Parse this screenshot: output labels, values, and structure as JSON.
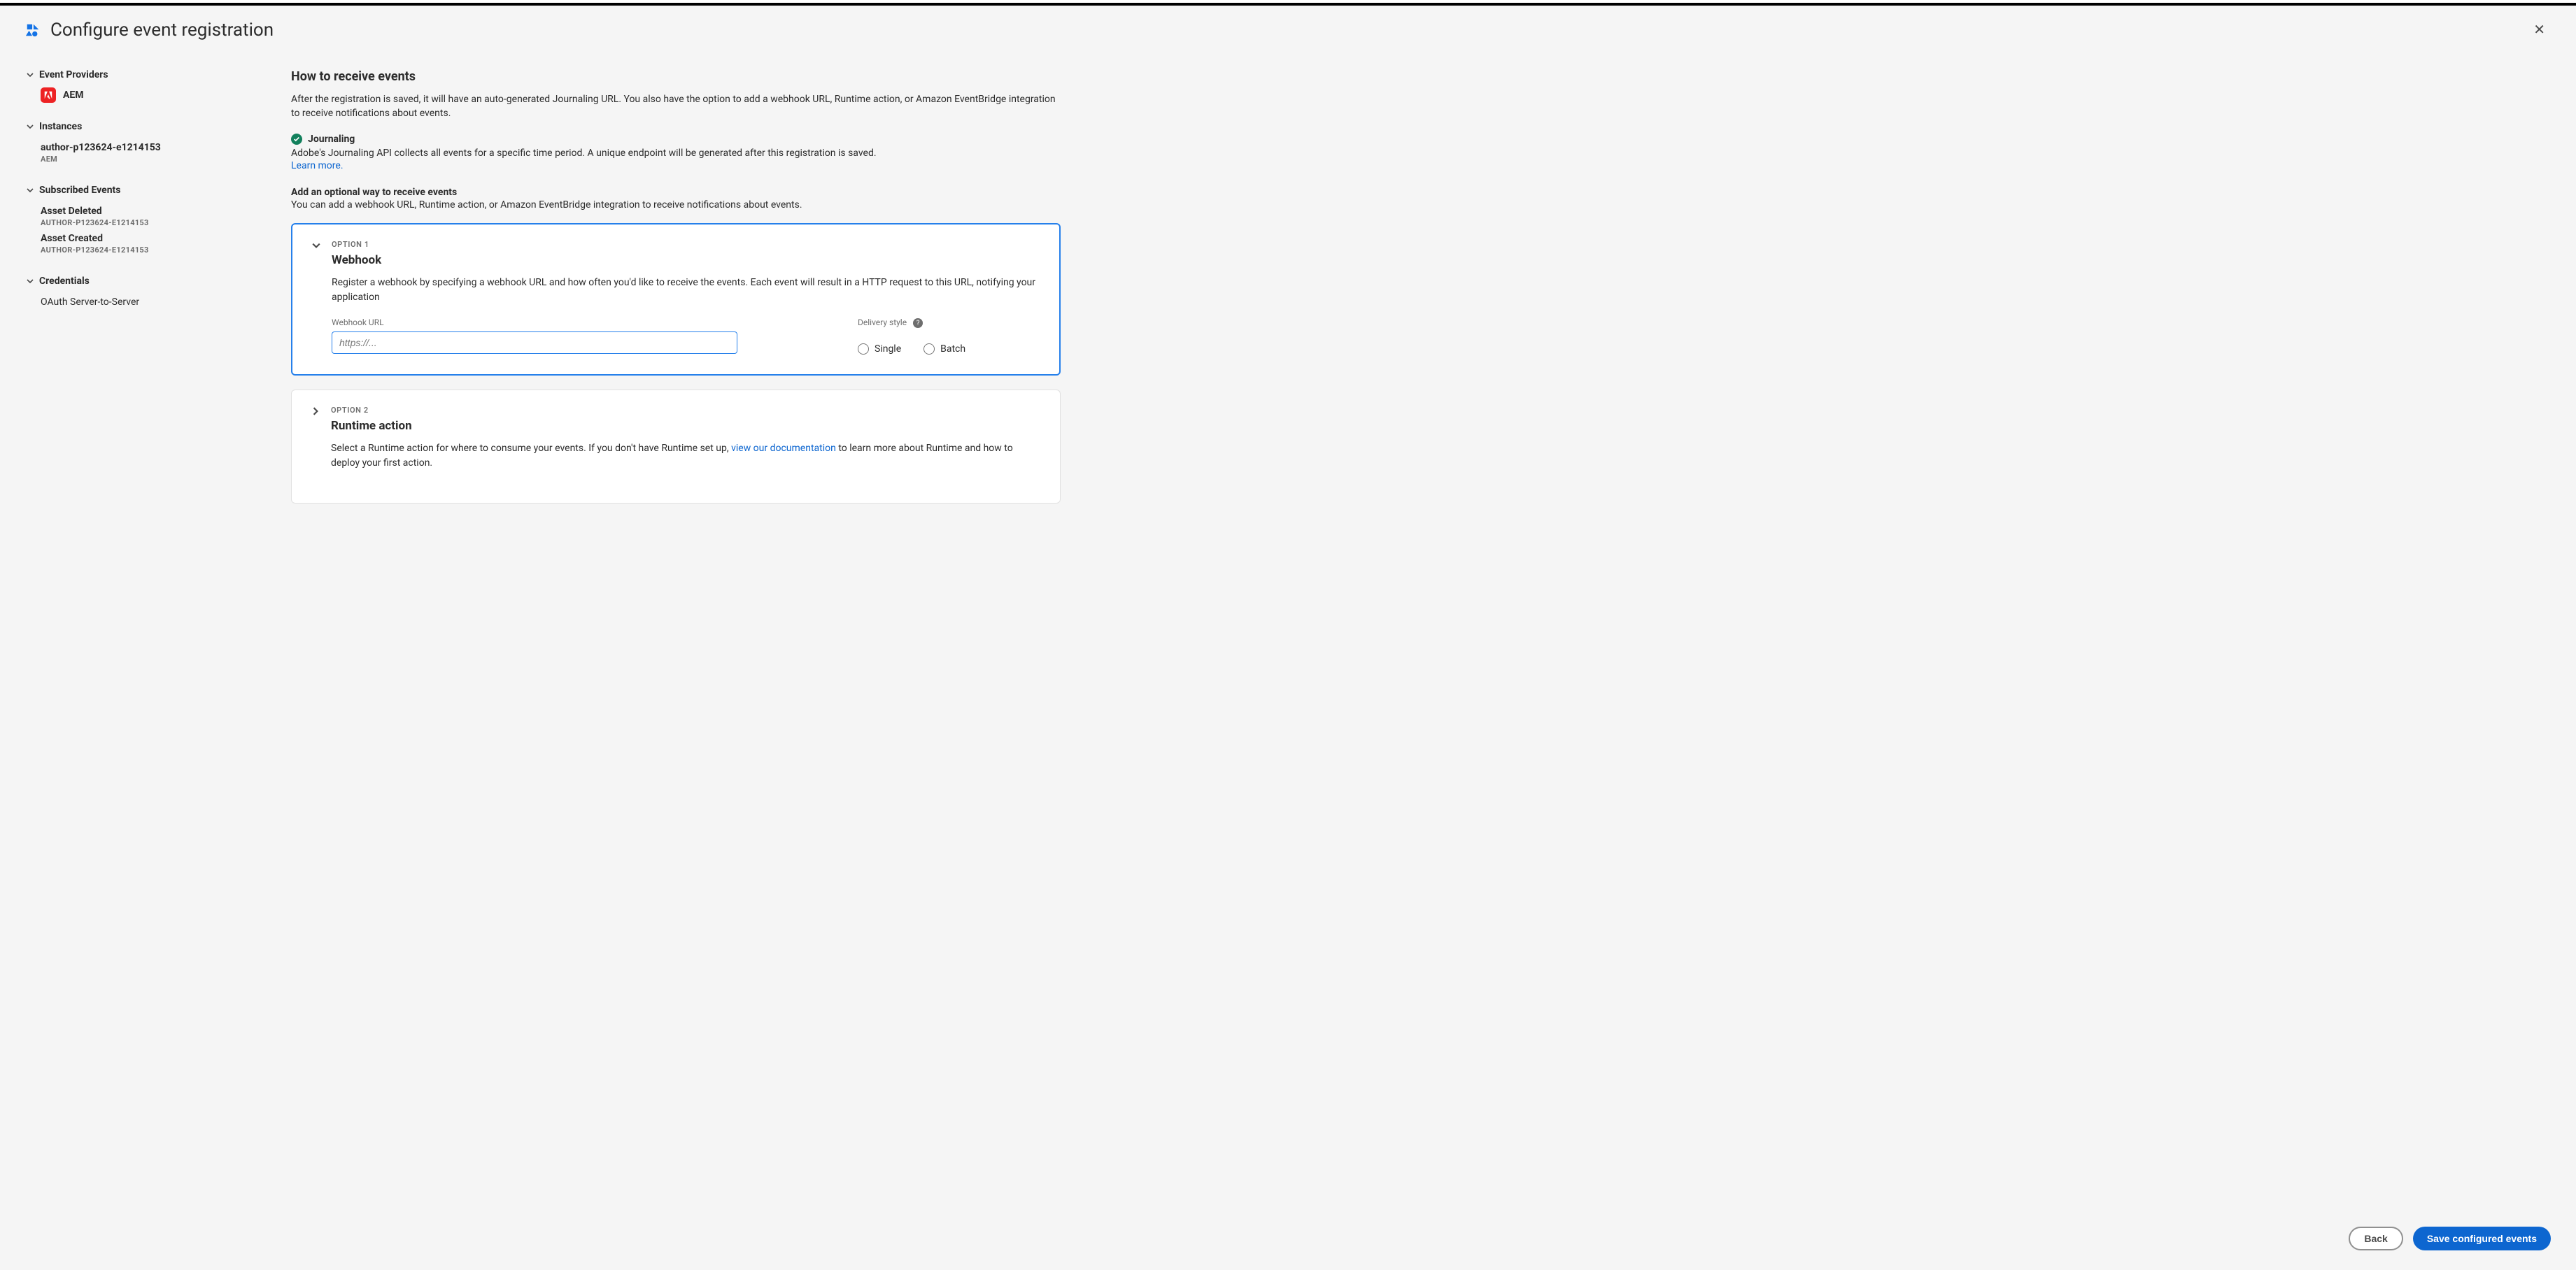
{
  "header": {
    "title": "Configure event registration"
  },
  "sidebar": {
    "providers_heading": "Event Providers",
    "provider_name": "AEM",
    "instances_heading": "Instances",
    "instance_name": "author-p123624-e1214153",
    "instance_sub": "AEM",
    "events_heading": "Subscribed Events",
    "events": [
      {
        "name": "Asset Deleted",
        "source": "AUTHOR-P123624-E1214153"
      },
      {
        "name": "Asset Created",
        "source": "AUTHOR-P123624-E1214153"
      }
    ],
    "credentials_heading": "Credentials",
    "credential_name": "OAuth Server-to-Server"
  },
  "main": {
    "heading": "How to receive events",
    "lead": "After the registration is saved, it will have an auto-generated Journaling URL. You also have the option to add a webhook URL, Runtime action, or Amazon EventBridge integration to receive notifications about events.",
    "journaling_title": "Journaling",
    "journaling_desc": "Adobe's Journaling API collects all events for a specific time period. A unique endpoint will be generated after this registration is saved.",
    "learn_more": "Learn more.",
    "optional_heading": "Add an optional way to receive events",
    "optional_desc": "You can add a webhook URL, Runtime action, or Amazon EventBridge integration to receive notifications about events.",
    "option1": {
      "label": "OPTION 1",
      "title": "Webhook",
      "desc": "Register a webhook by specifying a webhook URL and how often you'd like to receive the events. Each event will result in a HTTP request to this URL, notifying your application",
      "url_label": "Webhook URL",
      "url_placeholder": "https://...",
      "delivery_label": "Delivery style",
      "radio_single": "Single",
      "radio_batch": "Batch"
    },
    "option2": {
      "label": "OPTION 2",
      "title": "Runtime action",
      "desc_pre": "Select a Runtime action for where to consume your events. If you don't have Runtime set up, ",
      "desc_link": "view our documentation",
      "desc_post": " to learn more about Runtime and how to deploy your first action."
    }
  },
  "footer": {
    "back": "Back",
    "save": "Save configured events"
  }
}
